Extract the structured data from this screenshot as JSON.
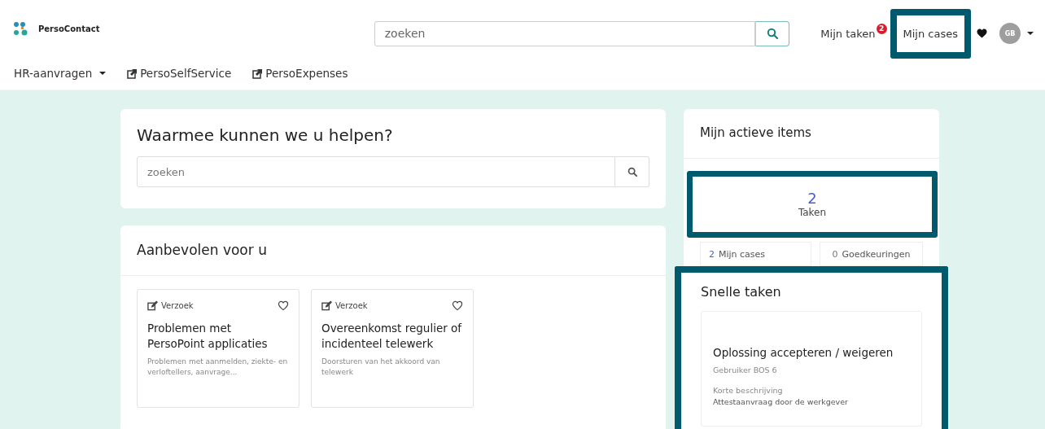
{
  "header": {
    "app_name": "PersoContact",
    "search": {
      "placeholder": "zoeken"
    },
    "links": [
      {
        "label": "Mijn taken",
        "badge": "2",
        "highlighted": false
      },
      {
        "label": "Mijn cases",
        "highlighted": true
      }
    ],
    "avatar": "GB"
  },
  "nav": [
    {
      "label": "HR-aanvragen",
      "kind": "dropdown"
    },
    {
      "label": "PersoSelfService",
      "kind": "external"
    },
    {
      "label": "PersoExpenses",
      "kind": "external"
    }
  ],
  "help": {
    "title": "Waarmee kunnen we u helpen?",
    "search": {
      "placeholder": "zoeken"
    }
  },
  "recommended": {
    "title": "Aanbevolen voor u",
    "cards": [
      {
        "type": "Verzoek",
        "title": "Problemen met PersoPoint applicaties",
        "description": "Problemen met aanmelden, ziekte- en verloftellers, aanvrage...",
        "favorite": false
      },
      {
        "type": "Verzoek",
        "title": "Overeenkomst regulier of incidenteel telewerk",
        "description": "Doorsturen van het akkoord van telewerk",
        "favorite": false
      }
    ]
  },
  "active_items": {
    "title": "Mijn actieve items",
    "main": {
      "count": "2",
      "label": "Taken",
      "highlighted": true
    },
    "tiles": [
      {
        "count": "2",
        "label": "Mijn cases",
        "kind": "link"
      },
      {
        "count": "0",
        "label": "Goedkeuringen",
        "kind": "plain"
      }
    ]
  },
  "quick_tasks": {
    "title": "Snelle taken",
    "highlighted": true,
    "task": {
      "title": "Oplossing accepteren / weigeren",
      "user": "Gebruiker BOS 6",
      "field_label": "Korte beschrijving",
      "field_value": "Attestaanvraag door de werkgever"
    }
  }
}
